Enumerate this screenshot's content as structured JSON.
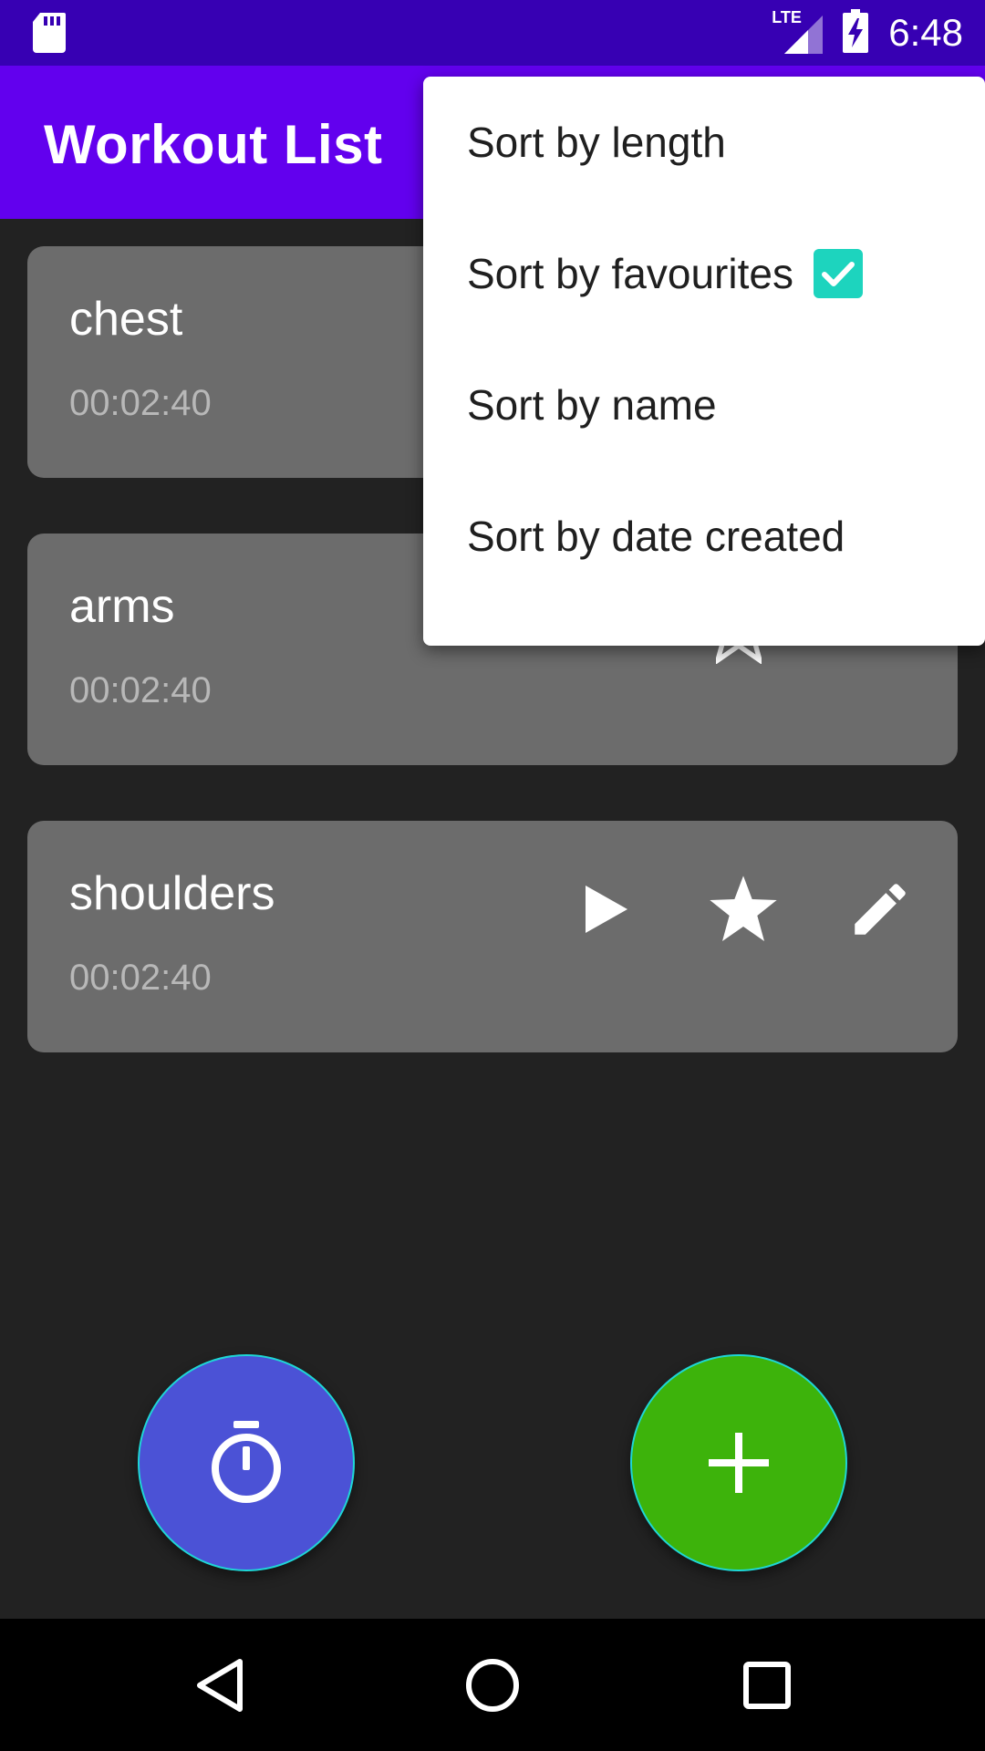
{
  "status_bar": {
    "time": "6:48",
    "network": "LTE",
    "icons": [
      "sd-card-icon",
      "signal-icon",
      "battery-charging-icon"
    ]
  },
  "app_bar": {
    "title": "Workout List",
    "color": "#6200EE"
  },
  "workouts": [
    {
      "name": "chest",
      "duration": "00:02:40"
    },
    {
      "name": "arms",
      "duration": "00:02:40"
    },
    {
      "name": "shoulders",
      "duration": "00:02:40"
    }
  ],
  "card_actions": [
    "play-icon",
    "star-icon",
    "edit-pencil-icon"
  ],
  "sort_menu": {
    "items": [
      {
        "label": "Sort by length",
        "checked": false
      },
      {
        "label": "Sort by favourites",
        "checked": true
      },
      {
        "label": "Sort by name",
        "checked": false
      },
      {
        "label": "Sort by date created",
        "checked": false
      }
    ],
    "check_color": "#1DD4BE"
  },
  "fabs": {
    "timer": {
      "icon": "stopwatch-icon",
      "color": "#4B52D6"
    },
    "add": {
      "icon": "plus-icon",
      "color": "#3DB30B"
    }
  },
  "nav_bar": [
    "back-icon",
    "home-icon",
    "recents-icon"
  ]
}
